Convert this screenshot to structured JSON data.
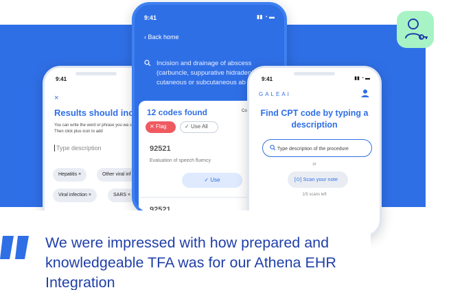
{
  "colors": {
    "brand_blue": "#2f6fe6",
    "flag_red": "#ef5a60",
    "badge_green": "#a7f3c6",
    "quote_text": "#1f3fa8"
  },
  "badge": {
    "icon": "user-key-icon"
  },
  "left_phone": {
    "time": "9:41",
    "close": "×",
    "heading": "Results should include",
    "subtext": "You can write the word or phrase you wa search. Then click plus icon to add",
    "input_placeholder": "Type description",
    "chips": [
      "Hepatitis ×",
      "Other viral inf",
      "Viral infection ×",
      "SARS ×"
    ]
  },
  "center_phone": {
    "time": "9:41",
    "back": "Back home",
    "query": "Incision and drainage of abscess (carbuncle, suppurative hidradeniti cutaneous or subcutaneous ab",
    "found": "12 codes found",
    "code_label": "Code",
    "flag": "Flag",
    "use_all": "Use All",
    "result1_code": "92521",
    "result1_desc": "Evaluation of speech fluency",
    "use": "Use",
    "result2_code": "92521"
  },
  "right_phone": {
    "time": "9:41",
    "brand": "GALEAI",
    "heading": "Find CPT code by typing a description",
    "search_placeholder": "Type description of the procedure",
    "or": "or",
    "scan": "Scan your note",
    "scans_left": "1/5 scans left"
  },
  "quote": {
    "text": "We were impressed with how prepared and knowledgeable TFA was for our Athena EHR Integration"
  }
}
